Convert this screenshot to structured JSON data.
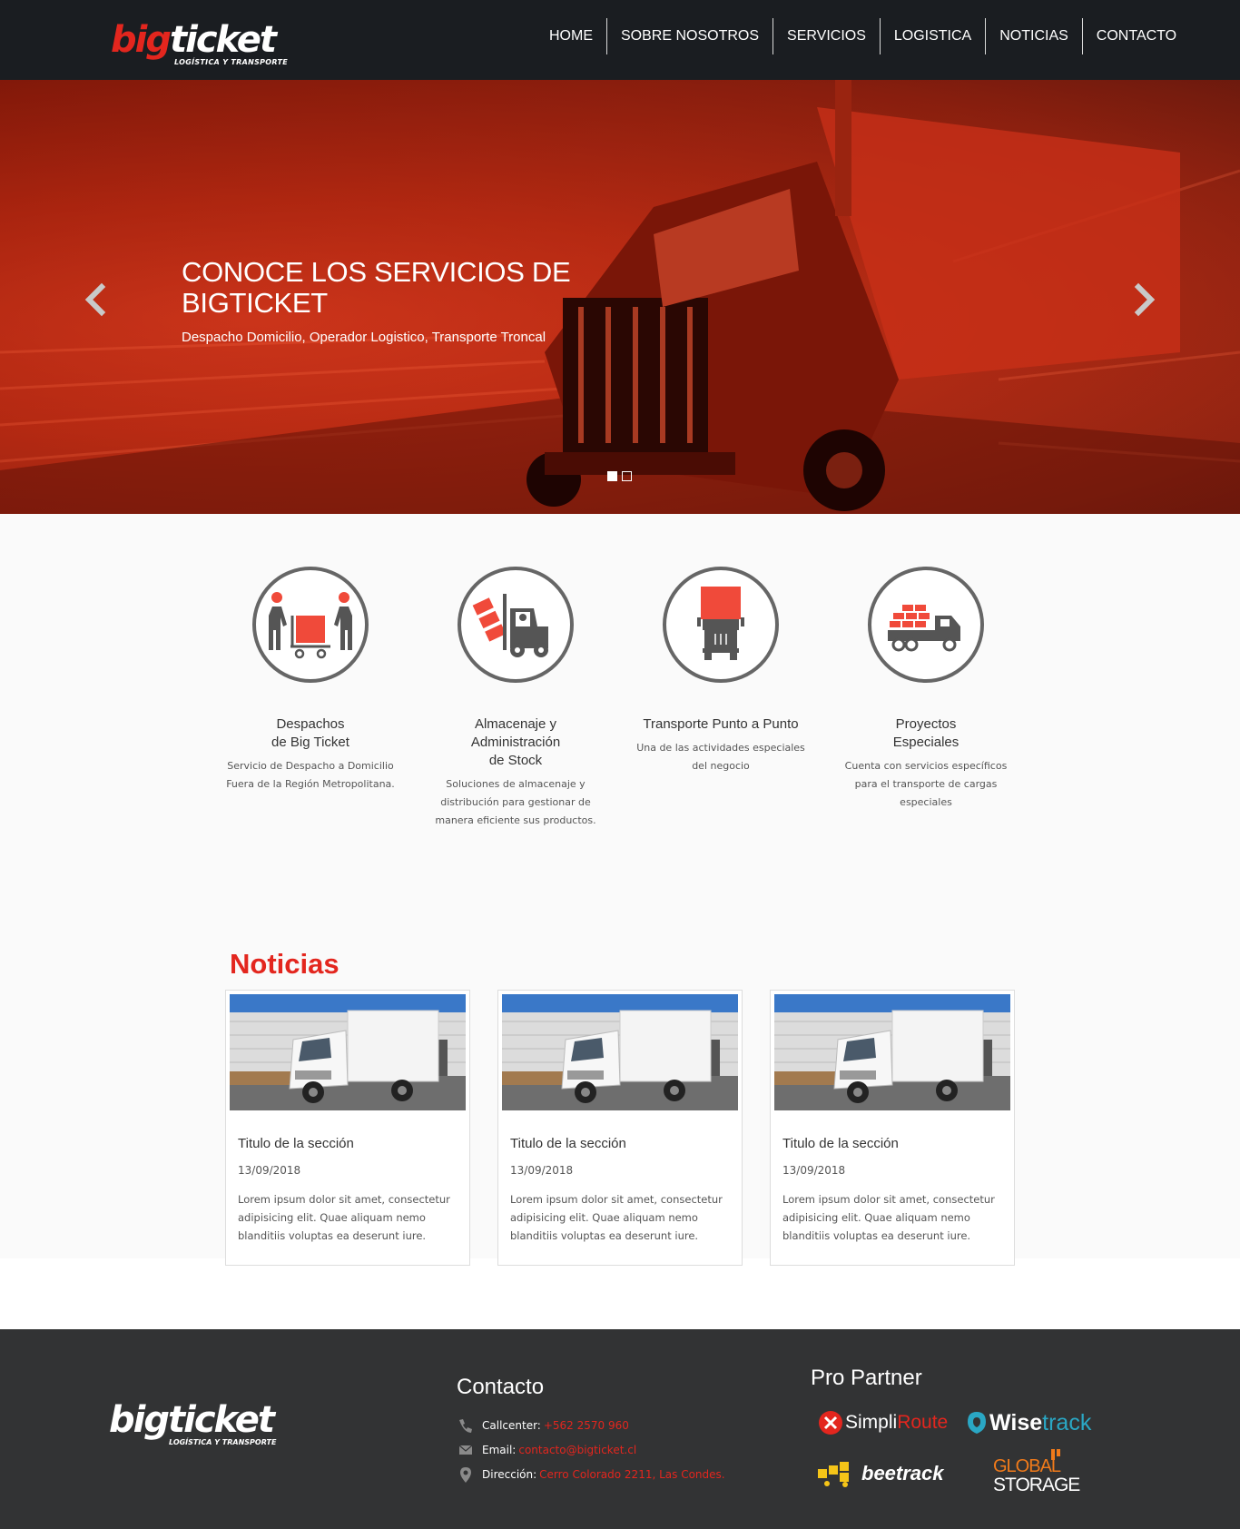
{
  "brand": {
    "name_part1": "big",
    "name_part2": "ticket",
    "tagline": "LOGÍSTICA Y TRANSPORTE"
  },
  "nav": {
    "items": [
      "HOME",
      "SOBRE NOSOTROS",
      "SERVICIOS",
      "LOGISTICA",
      "NOTICIAS",
      "CONTACTO"
    ]
  },
  "hero": {
    "title": "CONOCE LOS SERVICIOS DE BIGTICKET",
    "subtitle": "Despacho Domicilio, Operador Logistico, Transporte Troncal",
    "slides": 2,
    "active_slide": 1
  },
  "services": [
    {
      "title": "Despachos\nde Big Ticket",
      "desc": "Servicio de Despacho a Domicilio Fuera de la Región Metropolitana.",
      "icon": "people-cart-icon"
    },
    {
      "title": "Almacenaje y\nAdministración\nde Stock",
      "desc": "Soluciones de almacenaje y distribución para gestionar de manera eficiente sus productos.",
      "icon": "forklift-icon"
    },
    {
      "title": "Transporte Punto a Punto",
      "desc": "Una de las actividades especiales del negocio",
      "icon": "truck-front-icon"
    },
    {
      "title": "Proyectos\nEspeciales",
      "desc": "Cuenta con servicios específicos para el transporte de cargas especiales",
      "icon": "cargo-truck-icon"
    }
  ],
  "news": {
    "heading": "Noticias",
    "cards": [
      {
        "title": "Titulo de la sección",
        "date": "13/09/2018",
        "text": "Lorem ipsum dolor sit amet, consectetur adipisicing elit. Quae aliquam nemo blanditiis voluptas ea deserunt iure."
      },
      {
        "title": "Titulo de la sección",
        "date": "13/09/2018",
        "text": "Lorem ipsum dolor sit amet, consectetur adipisicing elit. Quae aliquam nemo blanditiis voluptas ea deserunt iure."
      },
      {
        "title": "Titulo de la sección",
        "date": "13/09/2018",
        "text": "Lorem ipsum dolor sit amet, consectetur adipisicing elit. Quae aliquam nemo blanditiis voluptas ea deserunt iure."
      }
    ]
  },
  "footer": {
    "contact_heading": "Contacto",
    "callcenter_label": "Callcenter:",
    "callcenter_value": "+562 2570 960",
    "email_label": "Email:",
    "email_value": "contacto@bigticket.cl",
    "address_label": "Dirección:",
    "address_value": "Cerro Colorado 2211, Las Condes.",
    "partner_heading": "Pro Partner",
    "partners": {
      "simpliroute_a": "Simpli",
      "simpliroute_b": "Route",
      "wisetrack_a": "Wise",
      "wisetrack_b": "track",
      "beetrack": "beetrack",
      "global_a": "GLOBAL",
      "global_b": "STORAGE"
    }
  },
  "colors": {
    "accent": "#e3261e",
    "nav_bg": "#1a1d21",
    "footer_bg": "#323334",
    "icon_gray": "#666666",
    "icon_red": "#f04a3a"
  }
}
